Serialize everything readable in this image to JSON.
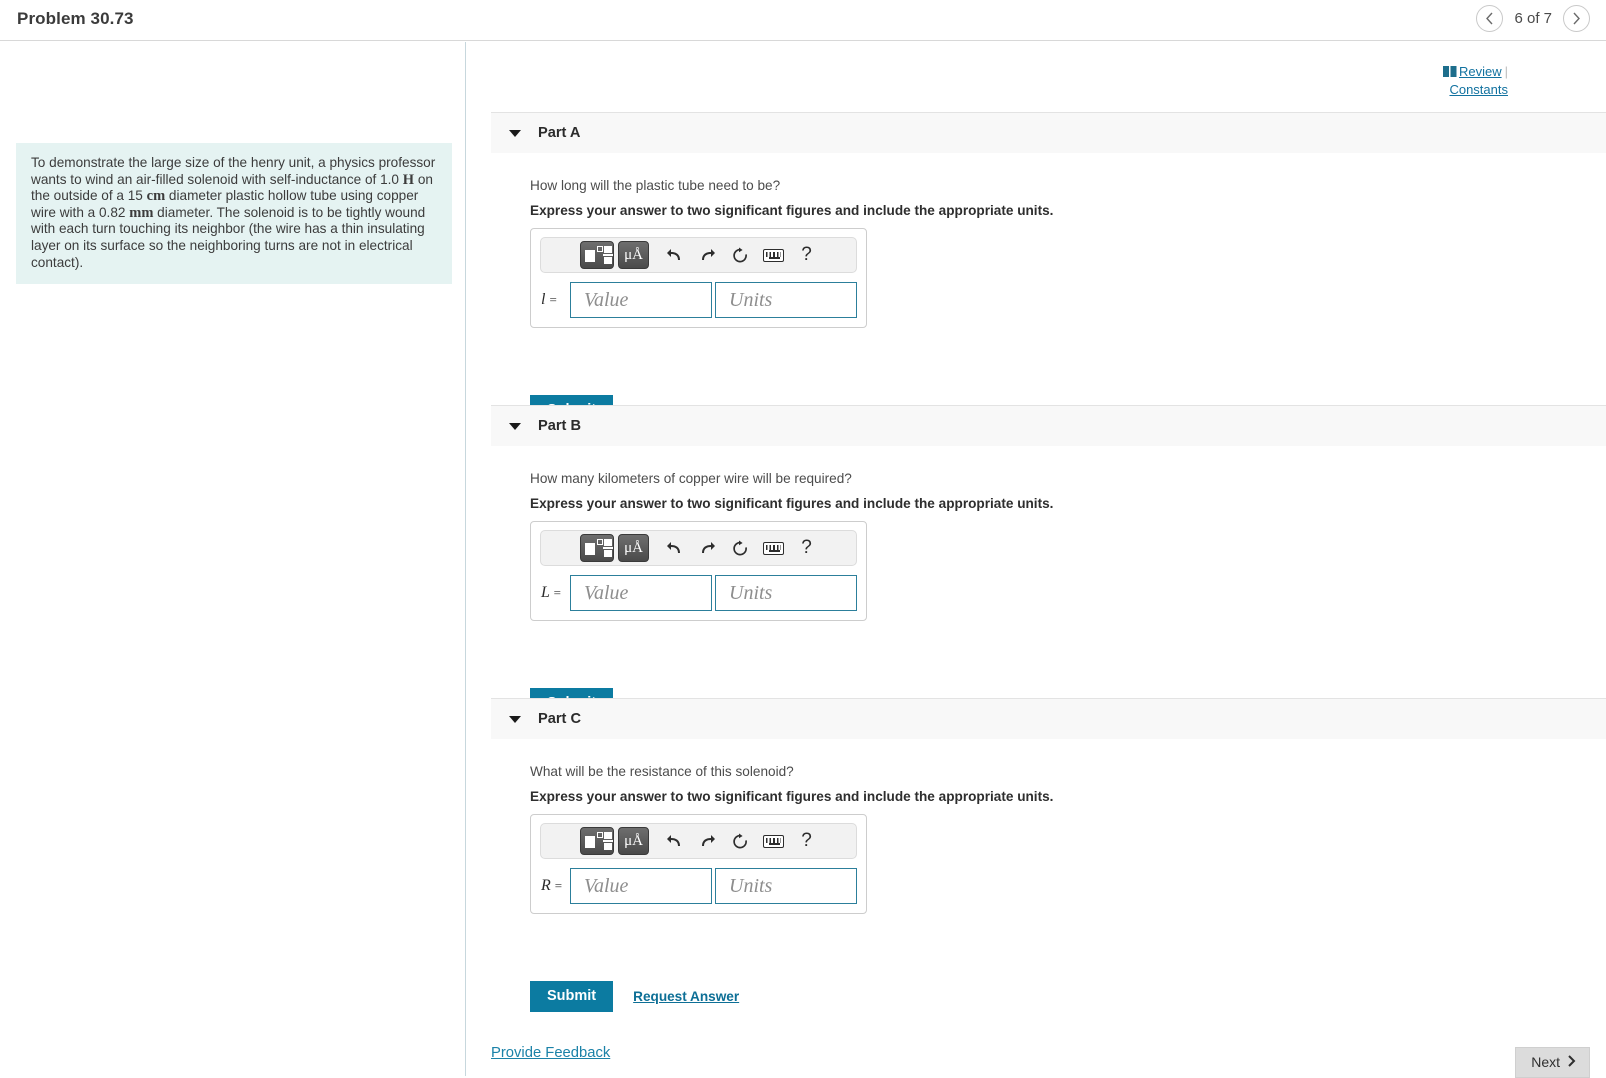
{
  "topbar": {
    "problem_title": "Problem 30.73",
    "pager_label": "6 of 7",
    "prev_icon": "chevron-left-icon",
    "next_icon": "chevron-right-icon"
  },
  "left_panel": {
    "problem_statement_parts": [
      {
        "t": "To demonstrate the large size of the henry unit, a physics professor wants to wind an air-filled solenoid with self-inductance of 1.0 ",
        "u": false
      },
      {
        "t": "H",
        "u": true
      },
      {
        "t": " on the outside of a 15 ",
        "u": false
      },
      {
        "t": "cm",
        "u": true
      },
      {
        "t": " diameter plastic hollow tube using copper wire with a 0.82 ",
        "u": false
      },
      {
        "t": "mm",
        "u": true
      },
      {
        "t": " diameter. The solenoid is to be tightly wound with each turn touching its neighbor (the wire has a thin insulating layer on its surface so the neighboring turns are not in electrical contact).",
        "u": false
      }
    ]
  },
  "review": {
    "book_icon": "book-icon",
    "review_label": "Review",
    "separator": "|",
    "constants_label": "Constants"
  },
  "toolbar": {
    "template_icon": "math-template-icon",
    "unit_icon": "micro-angstrom-icon",
    "unit_label": "μÅ",
    "undo_icon": "undo-arrow-icon",
    "undo_glyph": "↶",
    "redo_icon": "redo-arrow-icon",
    "redo_glyph": "↷",
    "reset_icon": "reset-circle-icon",
    "reset_glyph": "↺",
    "keyboard_icon": "keyboard-icon",
    "help_icon": "help-question-icon",
    "help_glyph": "?"
  },
  "fields": {
    "value_placeholder": "Value",
    "units_placeholder": "Units",
    "value": ""
  },
  "actions": {
    "submit_label": "Submit",
    "request_answer_label": "Request Answer"
  },
  "parts": [
    {
      "id": "a",
      "title": "Part A",
      "caret_icon": "caret-down-icon",
      "question": "How long will the plastic tube need to be?",
      "instruction": "Express your answer to two significant figures and include the appropriate units.",
      "variable": "l",
      "equals": "="
    },
    {
      "id": "b",
      "title": "Part B",
      "caret_icon": "caret-down-icon",
      "question": "How many kilometers of copper wire will be required?",
      "instruction": "Express your answer to two significant figures and include the appropriate units.",
      "variable": "L",
      "equals": "="
    },
    {
      "id": "c",
      "title": "Part C",
      "caret_icon": "caret-down-icon",
      "question": "What will be the resistance of this solenoid?",
      "instruction": "Express your answer to two significant figures and include the appropriate units.",
      "variable": "R",
      "equals": "="
    }
  ],
  "footer": {
    "provide_feedback_label": "Provide Feedback",
    "next_label": "Next",
    "next_chevron": "❯"
  },
  "colors": {
    "accent_teal": "#0c7ba1",
    "link_blue": "#1272a0",
    "problem_bg": "#e5f3f2",
    "part_header_bg": "#f8f8f8",
    "input_border": "#2c7f9b"
  }
}
